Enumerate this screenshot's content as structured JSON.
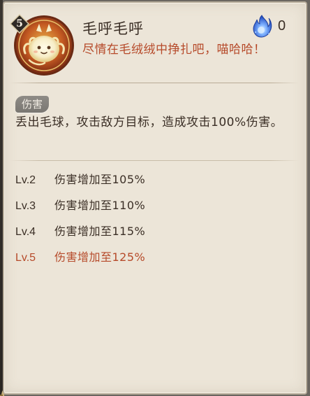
{
  "skill": {
    "level": "5",
    "name": "毛呼毛呼",
    "cost": "0",
    "flavor": "尽情在毛绒绒中挣扎吧，喵哈哈！",
    "tag": "伤害",
    "description": "丢出毛球，攻击敌方目标，造成攻击100%伤害。",
    "icon": "furball-spirit-icon",
    "cost_icon": "blue-soul-fire-icon"
  },
  "upgrades": [
    {
      "level": "Lv.2",
      "effect": "伤害增加至105%"
    },
    {
      "level": "Lv.3",
      "effect": "伤害增加至110%"
    },
    {
      "level": "Lv.4",
      "effect": "伤害增加至115%"
    },
    {
      "level": "Lv.5",
      "effect": "伤害增加至125%"
    }
  ],
  "colors": {
    "panel_bg": "#ece5d8",
    "text": "#3b2f26",
    "accent_red": "#b64a2a",
    "tag_bg": "#8a8782",
    "fire_blue": "#4a7bd8"
  }
}
